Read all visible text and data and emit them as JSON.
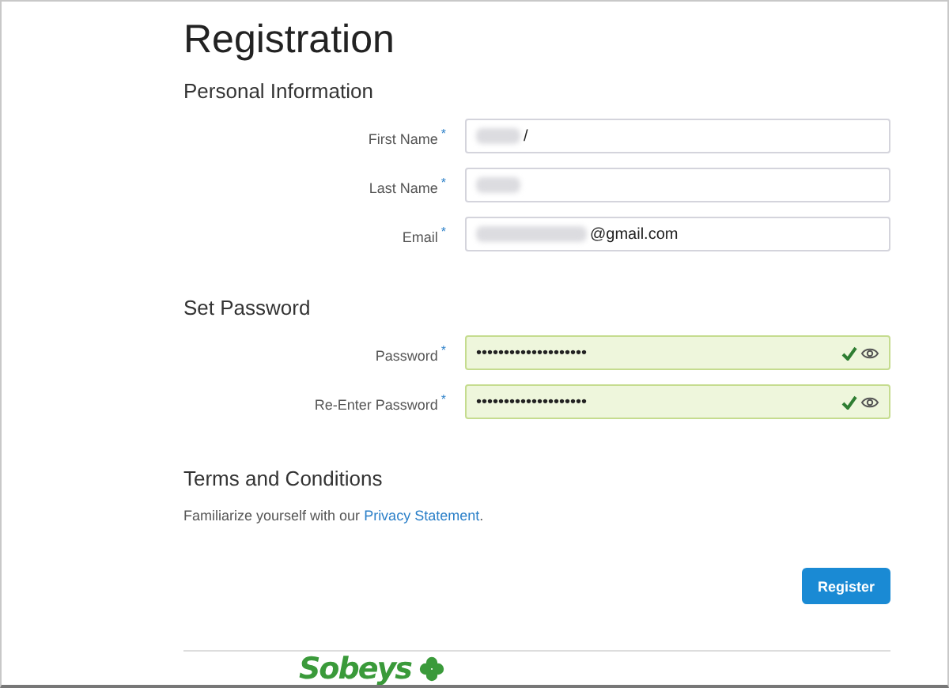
{
  "title": "Registration",
  "sections": [
    {
      "heading": "Personal Information",
      "fields": [
        {
          "label": "First Name",
          "required_mark": "*",
          "value": "/",
          "redacted": true,
          "valid": false
        },
        {
          "label": "Last Name",
          "required_mark": "*",
          "redacted": true,
          "valid": false
        },
        {
          "label": "Email",
          "required_mark": "*",
          "value": "@gmail.com",
          "redacted": true,
          "valid": false
        }
      ]
    },
    {
      "heading": "Set Password",
      "fields": [
        {
          "label": "Password",
          "required_mark": "*",
          "value": "••••••••••••••••••••",
          "valid": true,
          "reveal": true
        },
        {
          "label": "Re-Enter Password",
          "required_mark": "*",
          "value": "••••••••••••••••••••",
          "valid": true,
          "reveal": true
        }
      ]
    }
  ],
  "terms": {
    "heading": "Terms and Conditions",
    "text": "Familiarize yourself with our",
    "link": "Privacy Statement",
    "after": "."
  },
  "register_button": "Register",
  "logo": "Sobeys"
}
